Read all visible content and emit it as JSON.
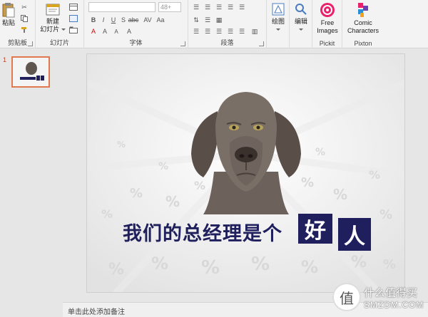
{
  "ribbon": {
    "clipboard": {
      "paste_label": "粘贴",
      "group_label": "剪贴板"
    },
    "slides": {
      "new_slide_label_line1": "新建",
      "new_slide_label_line2": "幻灯片",
      "group_label": "幻灯片"
    },
    "font": {
      "font_name": "",
      "font_size": "48+",
      "group_label": "字体"
    },
    "paragraph": {
      "group_label": "段落"
    },
    "drawing": {
      "label": "绘图"
    },
    "editing": {
      "label": "编辑"
    },
    "pickit": {
      "label_line1": "Free",
      "label_line2": "Images",
      "group_label": "Pickit"
    },
    "pixton": {
      "label_line1": "Comic",
      "label_line2": "Characters",
      "group_label": "Pixton"
    }
  },
  "slide_panel": {
    "slide_number": "1"
  },
  "slide": {
    "headline_prefix": "我们的总经理是个",
    "headline_box1": "好",
    "headline_box2": "人",
    "bg_symbol": "%"
  },
  "notes": {
    "placeholder": "单击此处添加备注"
  },
  "watermark": {
    "icon_char": "值",
    "line1": "什么值得买",
    "line2": "SMZDM.COM"
  },
  "colors": {
    "accent": "#1e1f5c",
    "thumb_border": "#e07a4e",
    "pickit": "#e8216a"
  }
}
